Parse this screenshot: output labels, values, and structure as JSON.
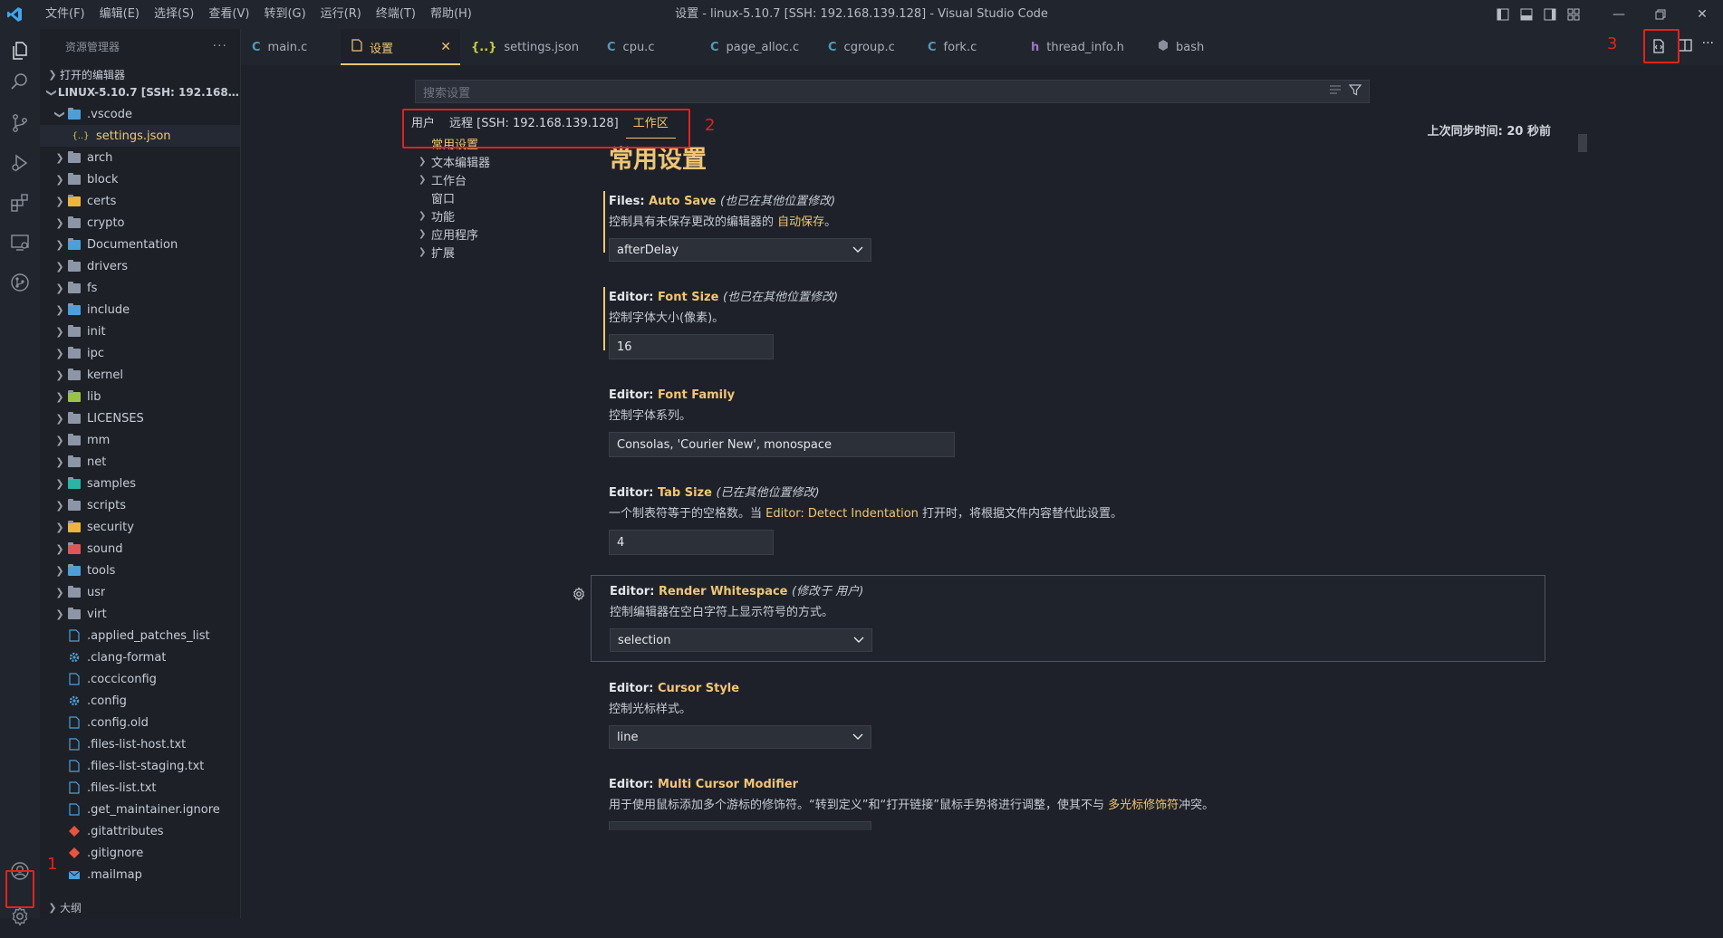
{
  "titlebar": {
    "menu": [
      "文件(F)",
      "编辑(E)",
      "选择(S)",
      "查看(V)",
      "转到(G)",
      "运行(R)",
      "终端(T)",
      "帮助(H)"
    ],
    "window_title": "设置 - linux-5.10.7 [SSH: 192.168.139.128] - Visual Studio Code"
  },
  "sidebar": {
    "header": "资源管理器",
    "header_more": "···",
    "open_editors": "打开的编辑器",
    "root": "LINUX-5.10.7 [SSH: 192.168.139...",
    "vscode_folder": ".vscode",
    "settings_file": "settings.json",
    "folders": [
      "arch",
      "block",
      "certs",
      "crypto",
      "Documentation",
      "drivers",
      "fs",
      "include",
      "init",
      "ipc",
      "kernel",
      "lib",
      "LICENSES",
      "mm",
      "net",
      "samples",
      "scripts",
      "security",
      "sound",
      "tools",
      "usr",
      "virt"
    ],
    "files": [
      ".applied_patches_list",
      ".clang-format",
      ".cocciconfig",
      ".config",
      ".config.old",
      ".files-list-host.txt",
      ".files-list-staging.txt",
      ".files-list.txt",
      ".get_maintainer.ignore",
      ".gitattributes",
      ".gitignore",
      ".mailmap"
    ],
    "outline": "大纲"
  },
  "tabs": [
    {
      "label": "main.c",
      "icon": "C"
    },
    {
      "label": "设置",
      "icon": "settings-file-icon"
    },
    {
      "label": "settings.json",
      "icon": "{..}"
    },
    {
      "label": "cpu.c",
      "icon": "C"
    },
    {
      "label": "page_alloc.c",
      "icon": "C"
    },
    {
      "label": "cgroup.c",
      "icon": "C"
    },
    {
      "label": "fork.c",
      "icon": "C"
    },
    {
      "label": "thread_info.h",
      "icon": "h"
    },
    {
      "label": "bash",
      "icon": "bash-icon"
    }
  ],
  "settings_editor": {
    "search_placeholder": "搜索设置",
    "scopes": [
      "用户",
      "远程 [SSH: 192.168.139.128]",
      "工作区"
    ],
    "sync_status": "上次同步时间: 20 秒前",
    "toc": [
      "常用设置",
      "文本编辑器",
      "工作台",
      "窗口",
      "功能",
      "应用程序",
      "扩展"
    ],
    "section_title": "常用设置",
    "items": [
      {
        "prefix": "Files: ",
        "key": "Auto Save",
        "note": "(也已在其他位置修改)",
        "desc_a": "控制具有未保存更改的编辑器的 ",
        "desc_link": "自动保存",
        "desc_b": "。",
        "value": "afterDelay"
      },
      {
        "prefix": "Editor: ",
        "key": "Font Size",
        "note": "(也已在其他位置修改)",
        "desc": "控制字体大小(像素)。",
        "value": "16"
      },
      {
        "prefix": "Editor: ",
        "key": "Font Family",
        "desc": "控制字体系列。",
        "value": "Consolas, 'Courier New', monospace"
      },
      {
        "prefix": "Editor: ",
        "key": "Tab Size",
        "note": "(已在其他位置修改)",
        "desc_a": "一个制表符等于的空格数。当 ",
        "desc_link": "Editor: Detect Indentation",
        "desc_b": " 打开时，将根据文件内容替代此设置。",
        "value": "4"
      },
      {
        "prefix": "Editor: ",
        "key": "Render Whitespace",
        "note": "(修改于 用户)",
        "desc": "控制编辑器在空白字符上显示符号的方式。",
        "value": "selection"
      },
      {
        "prefix": "Editor: ",
        "key": "Cursor Style",
        "desc": "控制光标样式。",
        "value": "line"
      },
      {
        "prefix": "Editor: ",
        "key": "Multi Cursor Modifier",
        "desc_a": "用于使用鼠标添加多个游标的修饰符。“转到定义”和“打开链接”鼠标手势将进行调整，使其不与 ",
        "desc_link": "多光标修饰符",
        "desc_b": "冲突。"
      }
    ]
  },
  "annotations": [
    "1",
    "2",
    "3"
  ],
  "colors": {
    "accent": "#f0c674",
    "annotation": "#e0241b",
    "bg": "#1e2129"
  }
}
